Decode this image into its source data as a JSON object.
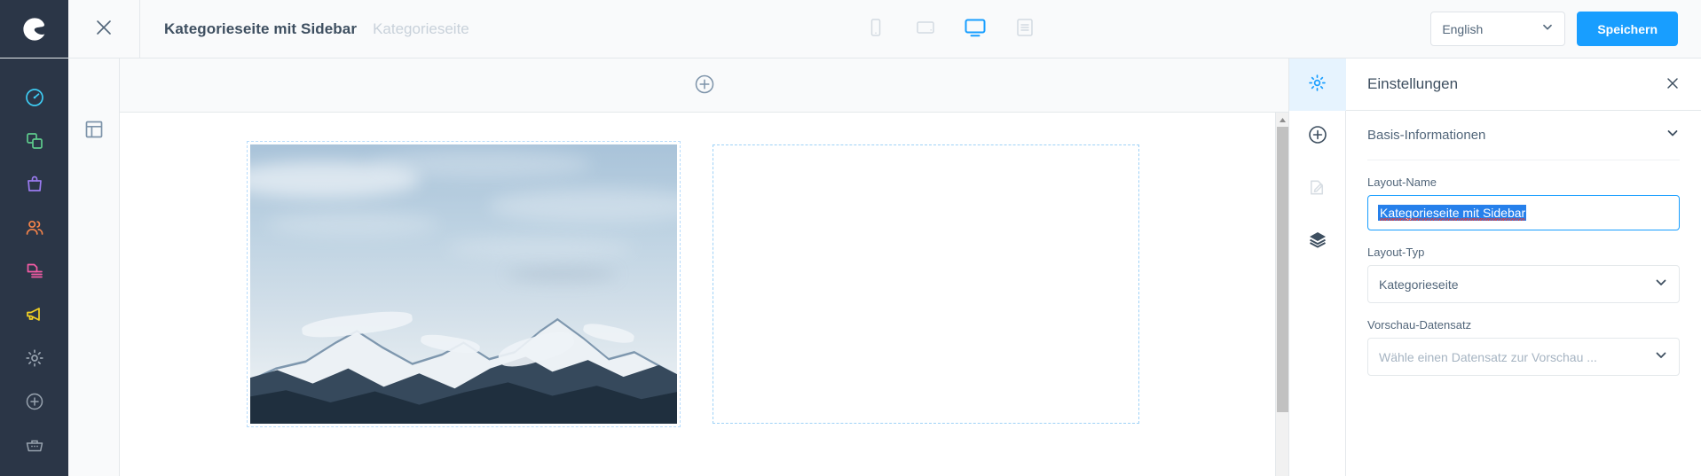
{
  "header": {
    "brand_icon": "shopware-logo-icon",
    "close_icon": "close-icon",
    "title": "Kategorieseite mit Sidebar",
    "subtitle": "Kategorieseite",
    "devices": [
      {
        "name": "mobile-view",
        "icon": "mobile-icon",
        "active": false
      },
      {
        "name": "tablet-view",
        "icon": "tablet-icon",
        "active": false
      },
      {
        "name": "desktop-view",
        "icon": "desktop-icon",
        "active": true
      },
      {
        "name": "list-view",
        "icon": "list-icon",
        "active": false
      }
    ],
    "language": {
      "label": "English",
      "chevron_icon": "chevron-down-icon"
    },
    "save_label": "Speichern"
  },
  "main_nav": {
    "items": [
      {
        "name": "dashboard",
        "icon": "dashboard-gauge-icon",
        "color": "#3ecbf2"
      },
      {
        "name": "catalogue",
        "icon": "catalogue-copy-icon",
        "color": "#5ecb8c"
      },
      {
        "name": "orders",
        "icon": "orders-bag-icon",
        "color": "#9a7bf0"
      },
      {
        "name": "customers",
        "icon": "customers-people-icon",
        "color": "#f4834a"
      },
      {
        "name": "content",
        "icon": "content-document-icon",
        "color": "#f25ba4"
      },
      {
        "name": "marketing",
        "icon": "marketing-megaphone-icon",
        "color": "#f2d024"
      },
      {
        "name": "settings",
        "icon": "settings-gear-icon",
        "color": "#97a2ae"
      }
    ],
    "bottom_items": [
      {
        "name": "add-shortcut",
        "icon": "plus-circle-icon",
        "color": "#97a2ae"
      },
      {
        "name": "extensions-store",
        "icon": "basket-icon",
        "color": "#97a2ae"
      }
    ]
  },
  "tool_rail": {
    "items": [
      {
        "name": "layout-blocks",
        "icon": "layout-grid-icon"
      }
    ]
  },
  "canvas": {
    "add_section_icon": "plus-circle-icon",
    "blocks": [
      {
        "name": "image-block",
        "type": "image",
        "alt": "Schneebedeckte Bergkette unter blauem Himmel"
      },
      {
        "name": "empty-block",
        "type": "placeholder"
      }
    ],
    "scrollbar": {
      "up_arrow_icon": "chevron-up-icon"
    }
  },
  "settings_rail": {
    "items": [
      {
        "name": "settings-tab",
        "icon": "settings-gear-icon",
        "active": true,
        "disabled": false
      },
      {
        "name": "add-block-tab",
        "icon": "plus-circle-icon",
        "active": false,
        "disabled": false
      },
      {
        "name": "edit-tab",
        "icon": "edit-document-icon",
        "active": false,
        "disabled": true
      },
      {
        "name": "layers-tab",
        "icon": "layers-icon",
        "active": false,
        "disabled": false
      }
    ]
  },
  "settings_panel": {
    "title": "Einstellungen",
    "close_icon": "close-icon",
    "section": {
      "title": "Basis-Informationen",
      "chevron_icon": "chevron-down-icon"
    },
    "layout_name": {
      "label": "Layout-Name",
      "value": "Kategorieseite mit Sidebar",
      "selected": true,
      "spellcheck_error": true
    },
    "layout_type": {
      "label": "Layout-Typ",
      "value": "Kategorieseite",
      "chevron_icon": "chevron-down-icon"
    },
    "preview_record": {
      "label": "Vorschau-Datensatz",
      "placeholder": "Wähle einen Datensatz zur Vorschau ...",
      "value": "",
      "chevron_icon": "chevron-down-icon"
    }
  },
  "colors": {
    "accent": "#189eff",
    "nav_dark": "#2b3647",
    "text": "#52667a",
    "title": "#3e4f60",
    "muted": "#c8d1da",
    "border": "#e4e8eb",
    "selection": "#2680eb",
    "active_tab_bg": "#e6f3fe"
  }
}
